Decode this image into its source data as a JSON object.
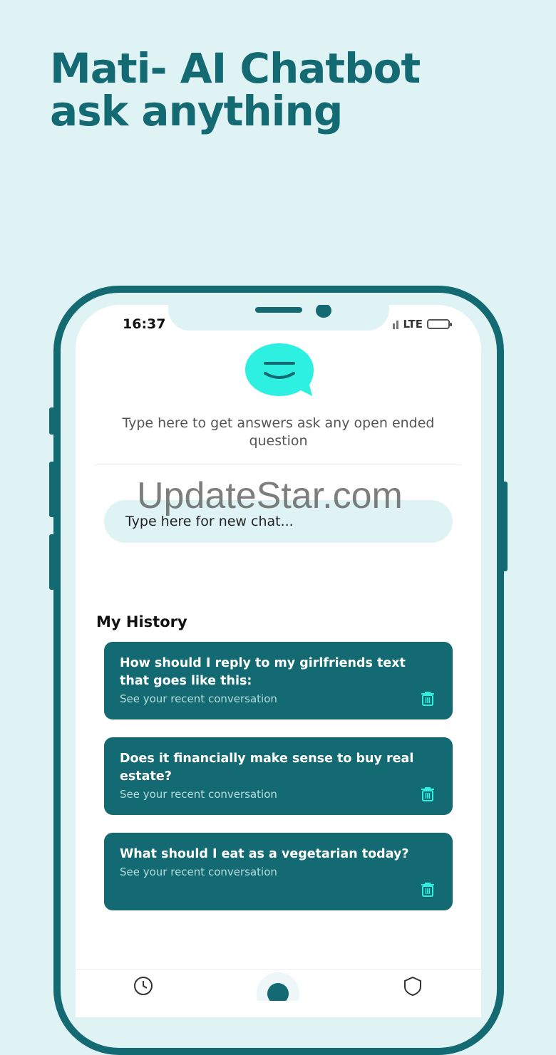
{
  "headline": {
    "line1": "Mati- AI Chatbot",
    "line2": "ask anything"
  },
  "status_bar": {
    "time": "16:37",
    "network": "LTE",
    "battery_color": "#f5c400"
  },
  "intro": {
    "text": "Type here to get answers ask any open ended question"
  },
  "chat_input": {
    "placeholder": "Type here for new chat..."
  },
  "watermark": "UpdateStar.com",
  "history": {
    "title": "My History",
    "items": [
      {
        "title": "How should I reply to my girlfriends text that goes like this:",
        "subtitle": "See your recent conversation"
      },
      {
        "title": "Does it financially make sense to buy real estate?",
        "subtitle": "See your recent conversation"
      },
      {
        "title": "What should I eat as a vegetarian today?",
        "subtitle": "See your recent conversation"
      }
    ]
  },
  "icons": {
    "logo": "smile-chat-bubble-icon",
    "delete": "trash-icon",
    "nav": [
      "history-icon",
      "home-icon",
      "shield-icon"
    ]
  },
  "colors": {
    "brand": "#136a72",
    "accent": "#2ef0e0",
    "background": "#e0f3f4"
  }
}
